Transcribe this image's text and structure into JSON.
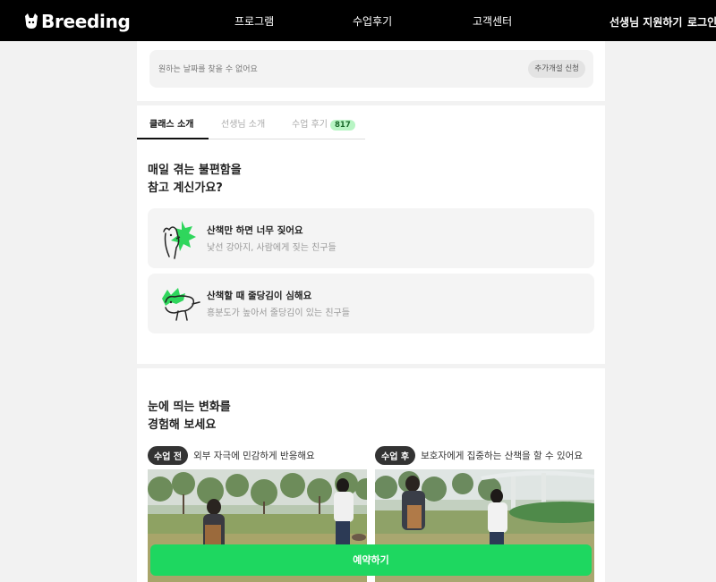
{
  "header": {
    "logo_text": "Breeding",
    "nav": [
      "프로그램",
      "수업후기",
      "고객센터"
    ],
    "apply_label": "선생님 지원하기",
    "login_label": "로그인"
  },
  "date_notice": {
    "text": "원하는 날짜를 찾을 수 없어요",
    "button_label": "추가개설 신청"
  },
  "tabs": [
    {
      "label": "클래스 소개"
    },
    {
      "label": "선생님 소개"
    },
    {
      "label": "수업 후기",
      "badge": "817"
    }
  ],
  "problem": {
    "heading_line1": "매일 겪는 불편함을",
    "heading_line2": "참고 계신가요?",
    "cards": [
      {
        "title": "산책만 하면 너무 짖어요",
        "subtitle": "낯선 강아지, 사람에게 짖는 친구들",
        "icon": "barking-dog-icon"
      },
      {
        "title": "산책할 때 줄당김이 심해요",
        "subtitle": "흥분도가 높아서 줄당김이 있는 친구들",
        "icon": "pulling-dog-icon"
      }
    ]
  },
  "change": {
    "heading_line1": "눈에 띄는 변화를",
    "heading_line2": "경험해 보세요",
    "before": {
      "pill": "수업 전",
      "text": "외부 자극에 민감하게 반응해요"
    },
    "after": {
      "pill": "수업 후",
      "text": "보호자에게 집중하는 산책을 할 수 있어요"
    }
  },
  "cta": {
    "label": "예약하기"
  },
  "colors": {
    "accent": "#1ed760",
    "header_bg": "#000000",
    "badge_bg": "#b8f5c4"
  }
}
